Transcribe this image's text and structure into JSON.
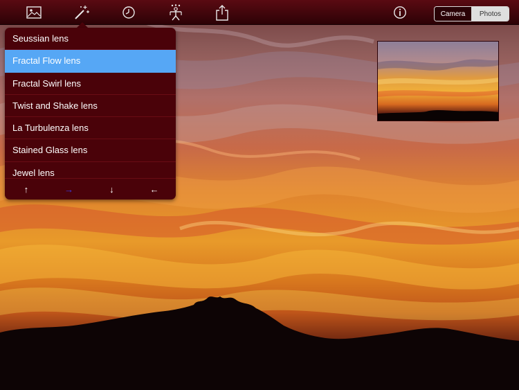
{
  "toolbar": {
    "icons": [
      "photo-library-icon",
      "magic-wand-icon",
      "clock-icon",
      "party-figure-icon",
      "share-icon",
      "info-icon"
    ],
    "segmented": {
      "camera_label": "Camera",
      "photos_label": "Photos",
      "selected": "Photos"
    }
  },
  "lens_menu": {
    "items": [
      {
        "label": "Seussian lens",
        "selected": false
      },
      {
        "label": "Fractal Flow lens",
        "selected": true
      },
      {
        "label": "Fractal Swirl lens",
        "selected": false
      },
      {
        "label": "Twist and Shake lens",
        "selected": false
      },
      {
        "label": "La Turbulenza lens",
        "selected": false
      },
      {
        "label": "Stained Glass lens",
        "selected": false
      },
      {
        "label": "Jewel lens",
        "selected": false
      }
    ],
    "nav": {
      "up": "↑",
      "right": "→",
      "down": "↓",
      "left": "←"
    }
  },
  "colors": {
    "toolbar_top": "#5a0a12",
    "toolbar_bottom": "#2c0206",
    "menu_bg": "#4a0209",
    "menu_selected": "#56a7f5",
    "nav_active": "#3a3cf0"
  }
}
